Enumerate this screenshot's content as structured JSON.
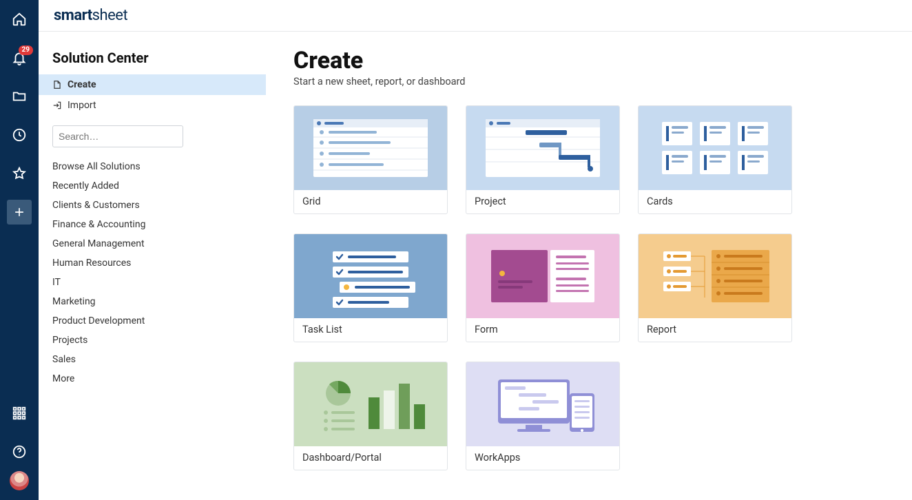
{
  "brand": {
    "strong": "smart",
    "light": "sheet"
  },
  "rail": {
    "notification_count": "29"
  },
  "sidebar": {
    "title": "Solution Center",
    "nav": {
      "create": "Create",
      "import": "Import"
    },
    "search_placeholder": "Search…",
    "categories": [
      "Browse All Solutions",
      "Recently Added",
      "Clients & Customers",
      "Finance & Accounting",
      "General Management",
      "Human Resources",
      "IT",
      "Marketing",
      "Product Development",
      "Projects",
      "Sales",
      "More"
    ]
  },
  "content": {
    "title": "Create",
    "subtitle": "Start a new sheet, report, or dashboard",
    "cards": {
      "grid": "Grid",
      "project": "Project",
      "cards": "Cards",
      "tasklist": "Task List",
      "form": "Form",
      "report": "Report",
      "dashboard": "Dashboard/Portal",
      "workapps": "WorkApps"
    }
  }
}
